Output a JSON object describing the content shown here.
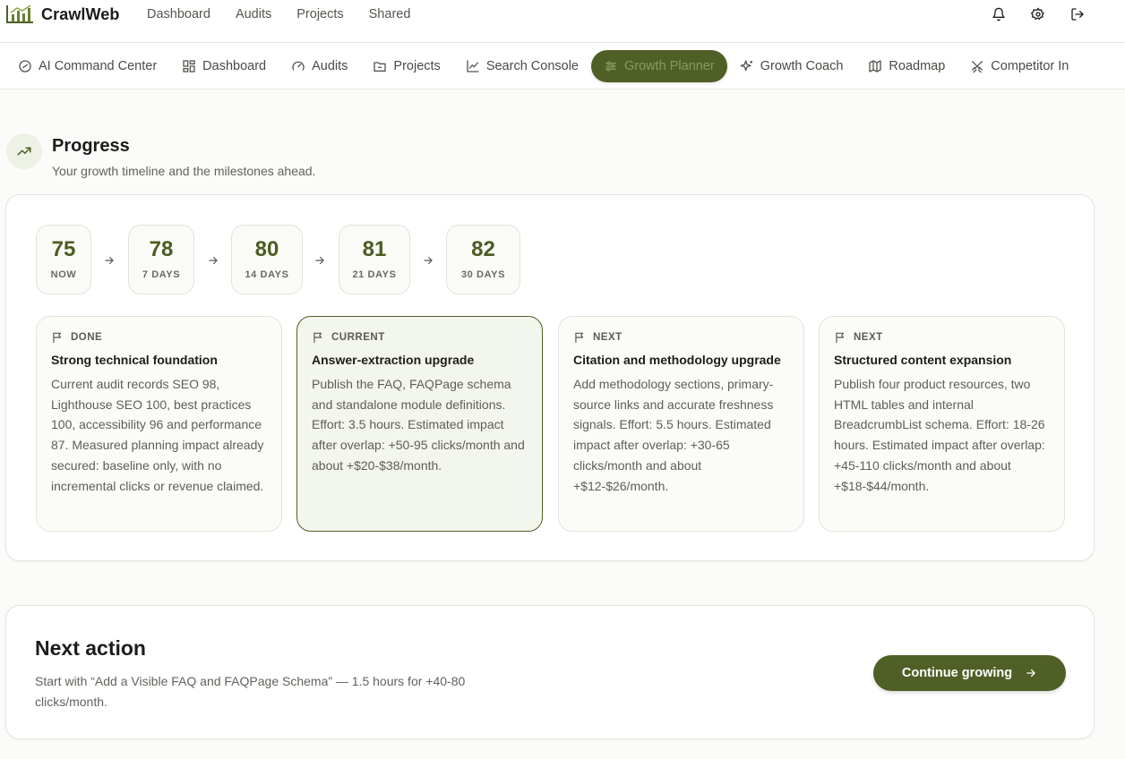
{
  "brand": {
    "name": "CrawlWeb",
    "logo_icon": "bar-chart-logo-icon"
  },
  "top_nav": [
    "Dashboard",
    "Audits",
    "Projects",
    "Shared"
  ],
  "top_icons": [
    "bell-icon",
    "gear-icon",
    "logout-icon"
  ],
  "tabs": [
    {
      "label": "AI Command Center",
      "icon": "target-icon"
    },
    {
      "label": "Dashboard",
      "icon": "grid-icon"
    },
    {
      "label": "Audits",
      "icon": "gauge-icon"
    },
    {
      "label": "Projects",
      "icon": "folder-icon"
    },
    {
      "label": "Search Console",
      "icon": "line-chart-icon"
    },
    {
      "label": "Growth Planner",
      "icon": "sliders-icon",
      "active": true
    },
    {
      "label": "Growth Coach",
      "icon": "sparkles-icon"
    },
    {
      "label": "Roadmap",
      "icon": "map-icon"
    },
    {
      "label": "Competitor In",
      "icon": "crossed-swords-icon"
    }
  ],
  "progress": {
    "title": "Progress",
    "subtitle": "Your growth timeline and the milestones ahead.",
    "icon": "trending-up-icon",
    "scores": [
      {
        "value": "75",
        "label": "NOW"
      },
      {
        "value": "78",
        "label": "7 DAYS"
      },
      {
        "value": "80",
        "label": "14 DAYS"
      },
      {
        "value": "81",
        "label": "21 DAYS"
      },
      {
        "value": "82",
        "label": "30 DAYS"
      }
    ],
    "milestones": [
      {
        "status": "DONE",
        "title": "Strong technical foundation",
        "description": "Current audit records SEO 98, Lighthouse SEO 100, best practices 100, accessibility 96 and performance 87. Measured planning impact already secured: baseline only, with no incremental clicks or revenue claimed."
      },
      {
        "status": "CURRENT",
        "title": "Answer-extraction upgrade",
        "description": "Publish the FAQ, FAQPage schema and standalone module definitions. Effort: 3.5 hours. Estimated impact after overlap: +50-95 clicks/month and about +$20-$38/month."
      },
      {
        "status": "NEXT",
        "title": "Citation and methodology upgrade",
        "description": "Add methodology sections, primary-source links and accurate freshness signals. Effort: 5.5 hours. Estimated impact after overlap: +30-65 clicks/month and about +$12-$26/month."
      },
      {
        "status": "NEXT",
        "title": "Structured content expansion",
        "description": "Publish four product resources, two HTML tables and internal BreadcrumbList schema. Effort: 18-26 hours. Estimated impact after overlap: +45-110 clicks/month and about +$18-$44/month."
      }
    ]
  },
  "next_action": {
    "title": "Next action",
    "description": "Start with “Add a Visible FAQ and FAQPage Schema” — 1.5 hours for +40-80 clicks/month.",
    "button_label": "Continue growing"
  },
  "colors": {
    "accent": "#4f5f25",
    "accent_text": "#4d5c22",
    "current_bg": "#f3f6ec"
  }
}
